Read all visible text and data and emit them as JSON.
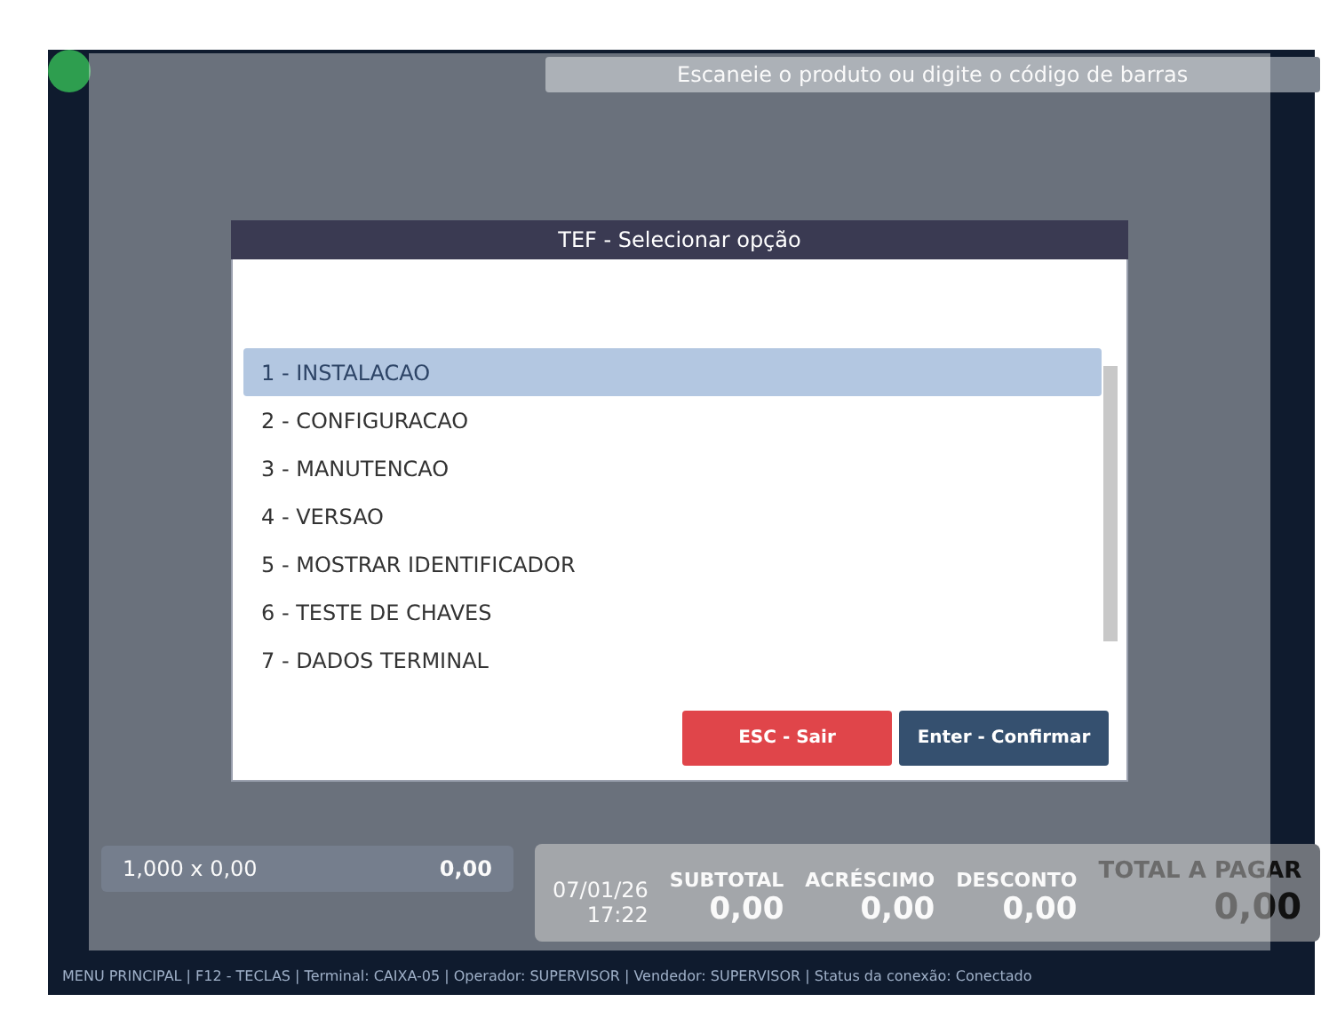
{
  "background": {
    "search": {
      "placeholder": "Escaneie o produto ou digite o código de barras"
    },
    "item_line": {
      "quantity": "1,000 x 0,00",
      "amount": "0,00"
    },
    "date": "07/01/26",
    "time": "17:22",
    "totals": [
      {
        "label": "SUBTOTAL",
        "value": "0,00"
      },
      {
        "label": "ACRÉSCIMO",
        "value": "0,00"
      },
      {
        "label": "DESCONTO",
        "value": "0,00"
      },
      {
        "label": "TOTAL A PAGAR",
        "value": "0,00"
      }
    ],
    "status_bar": "MENU PRINCIPAL | F12 - TECLAS | Terminal: CAIXA-05 | Operador: SUPERVISOR | Vendedor: SUPERVISOR | Status da conexão: Conectado"
  },
  "dialog": {
    "title": "TEF - Selecionar opção",
    "options": [
      {
        "label": "1 - INSTALACAO",
        "selected": true
      },
      {
        "label": "2 - CONFIGURACAO",
        "selected": false
      },
      {
        "label": "3 - MANUTENCAO",
        "selected": false
      },
      {
        "label": "4 - VERSAO",
        "selected": false
      },
      {
        "label": "5 - MOSTRAR IDENTIFICADOR",
        "selected": false
      },
      {
        "label": "6 - TESTE DE CHAVES",
        "selected": false
      },
      {
        "label": "7 - DADOS TERMINAL",
        "selected": false
      }
    ],
    "buttons": [
      {
        "label": "ESC - Sair",
        "kind": "cancel"
      },
      {
        "label": "Enter - Confirmar",
        "kind": "confirm"
      }
    ]
  }
}
